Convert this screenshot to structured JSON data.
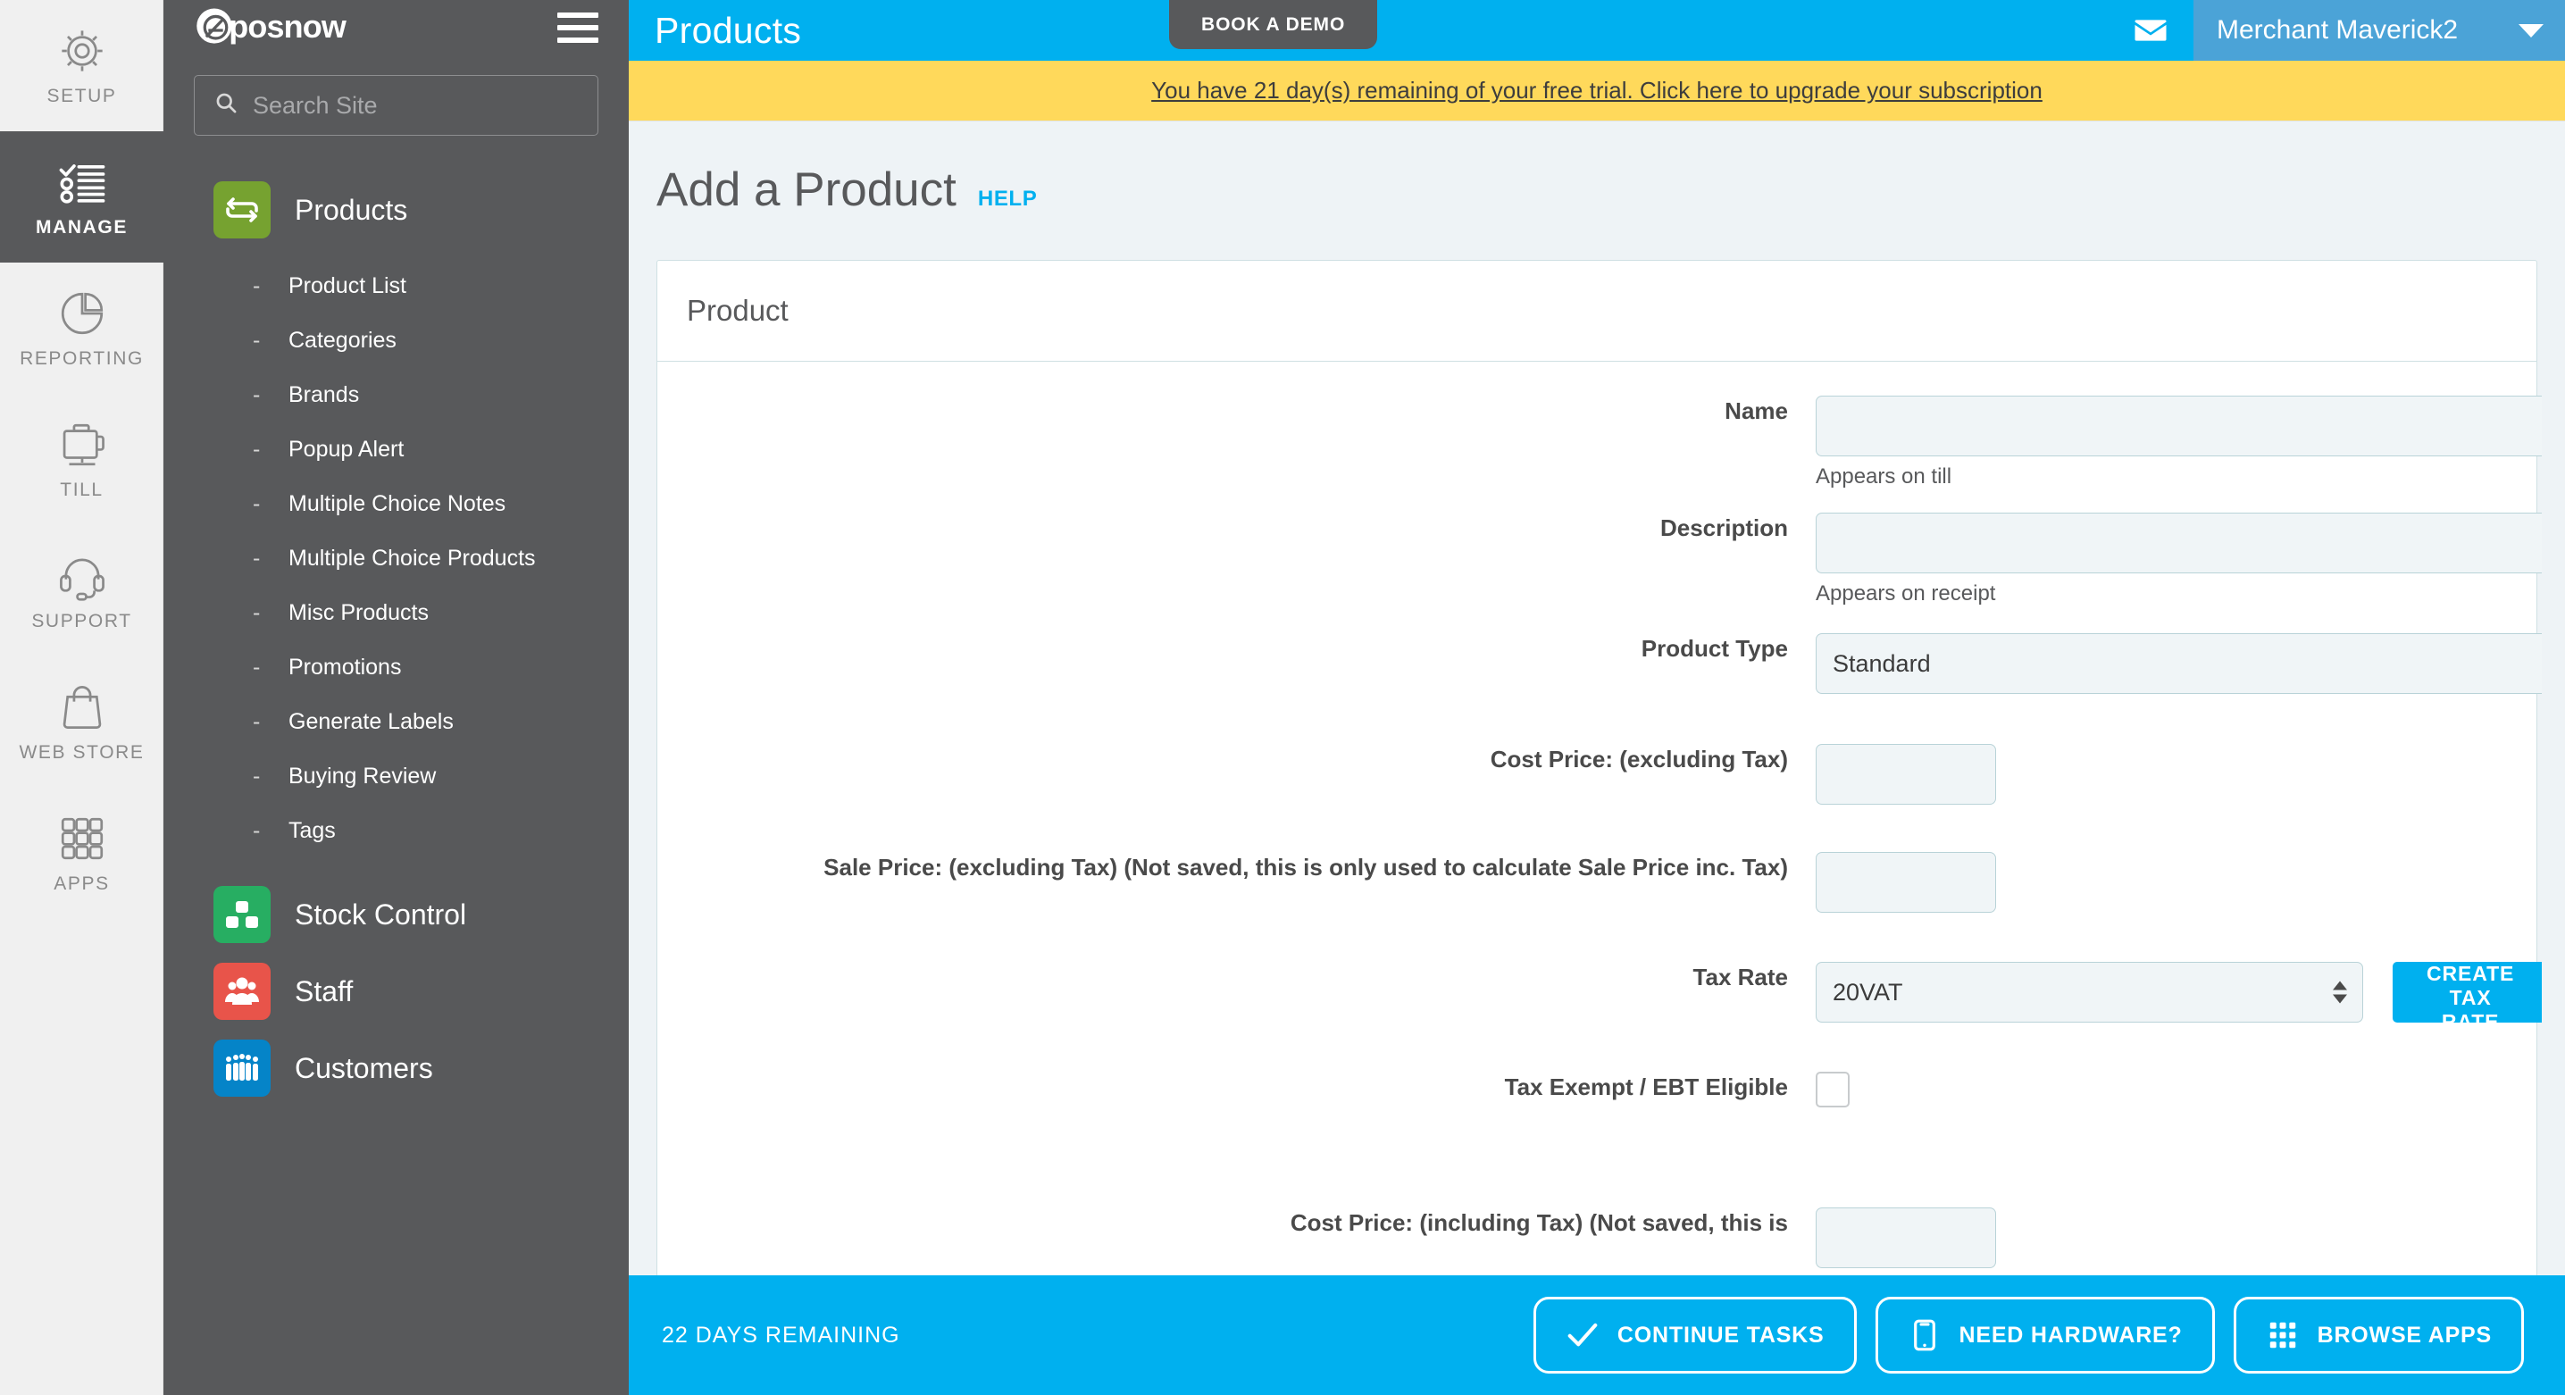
{
  "rail": {
    "items": [
      {
        "label": "SETUP",
        "icon": "gear-icon",
        "active": false
      },
      {
        "label": "MANAGE",
        "icon": "checklist-icon",
        "active": true
      },
      {
        "label": "REPORTING",
        "icon": "pie-chart-icon",
        "active": false
      },
      {
        "label": "TILL",
        "icon": "till-icon",
        "active": false
      },
      {
        "label": "SUPPORT",
        "icon": "headset-icon",
        "active": false
      },
      {
        "label": "WEB STORE",
        "icon": "shopping-bag-icon",
        "active": false
      },
      {
        "label": "APPS",
        "icon": "grid-apps-icon",
        "active": false
      }
    ]
  },
  "sidebar": {
    "logo_text": "eposnow",
    "search": {
      "placeholder": "Search Site",
      "value": ""
    },
    "groups": [
      {
        "label": "Products",
        "icon": "products-exchange-icon",
        "color": "#76a230",
        "children": [
          {
            "label": "Product List"
          },
          {
            "label": "Categories"
          },
          {
            "label": "Brands"
          },
          {
            "label": "Popup Alert"
          },
          {
            "label": "Multiple Choice Notes"
          },
          {
            "label": "Multiple Choice Products"
          },
          {
            "label": "Misc Products"
          },
          {
            "label": "Promotions"
          },
          {
            "label": "Generate Labels"
          },
          {
            "label": "Buying Review"
          },
          {
            "label": "Tags"
          }
        ]
      },
      {
        "label": "Stock Control",
        "icon": "blocks-icon",
        "color": "#27ae62",
        "children": []
      },
      {
        "label": "Staff",
        "icon": "people-icon",
        "color": "#e8544a",
        "children": []
      },
      {
        "label": "Customers",
        "icon": "customers-icon",
        "color": "#0584c8",
        "children": []
      }
    ]
  },
  "topbar": {
    "title": "Products",
    "book_demo_label": "BOOK A DEMO",
    "mail_icon": "envelope-icon",
    "user_name": "Merchant Maverick2",
    "caret_icon": "chevron-down-icon",
    "accent_color": "#00b0ef",
    "user_menu_color": "#4ba3d7"
  },
  "trial_banner": {
    "text": "You have 21 day(s) remaining of your free trial. Click here to upgrade your subscription",
    "background": "#ffd95b"
  },
  "page": {
    "title": "Add a Product",
    "help_label": "HELP"
  },
  "form": {
    "card_title": "Product",
    "fields": [
      {
        "label": "Name",
        "type": "text",
        "value": "",
        "hint": "Appears on till",
        "size": "wide",
        "name": "name-field"
      },
      {
        "label": "Description",
        "type": "text",
        "value": "",
        "hint": "Appears on receipt",
        "size": "wide",
        "name": "description-field"
      },
      {
        "label": "Product Type",
        "type": "select",
        "value": "Standard",
        "options": [
          "Standard"
        ],
        "hint": "",
        "size": "wide",
        "name": "product-type-select"
      },
      {
        "label": "Cost Price: (excluding Tax)",
        "type": "text",
        "value": "",
        "hint": "",
        "size": "small",
        "name": "cost-price-excluding-tax-field"
      },
      {
        "label": "Sale Price: (excluding Tax) (Not saved, this is only used to calculate Sale Price inc. Tax)",
        "type": "text",
        "value": "",
        "hint": "",
        "size": "small",
        "name": "sale-price-excluding-tax-field"
      },
      {
        "label": "Tax Rate",
        "type": "select-with-button",
        "value": "20VAT",
        "options": [
          "20VAT"
        ],
        "button_label": "CREATE TAX RATE",
        "hint": "",
        "size": "mid",
        "name": "tax-rate-select"
      },
      {
        "label": "Tax Exempt / EBT Eligible",
        "type": "checkbox",
        "checked": false,
        "hint": "",
        "name": "tax-exempt-checkbox"
      },
      {
        "label": "Cost Price: (including Tax) (Not saved, this is",
        "type": "text",
        "value": "",
        "hint": "",
        "size": "small",
        "name": "cost-price-including-tax-field"
      }
    ]
  },
  "bottombar": {
    "days_remaining": "22 DAYS REMAINING",
    "actions": [
      {
        "label": "CONTINUE TASKS",
        "icon": "check-icon"
      },
      {
        "label": "NEED HARDWARE?",
        "icon": "tablet-icon"
      },
      {
        "label": "BROWSE APPS",
        "icon": "grid-apps-icon"
      }
    ]
  }
}
